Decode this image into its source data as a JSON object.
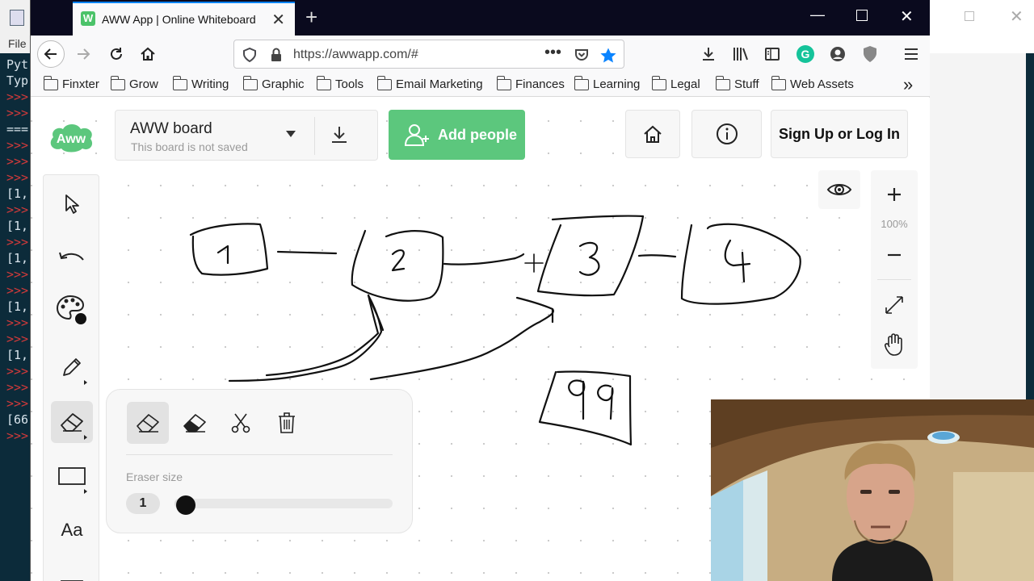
{
  "python": {
    "menu": "File",
    "lines": [
      {
        "t": "Pyt",
        "c": "w"
      },
      {
        "t": "Typ",
        "c": "w"
      },
      {
        "t": ">>>",
        "c": "r"
      },
      {
        "t": ">>>",
        "c": "r"
      },
      {
        "t": "===",
        "c": "w"
      },
      {
        "t": ">>>",
        "c": "r"
      },
      {
        "t": ">>>",
        "c": "r"
      },
      {
        "t": ">>>",
        "c": "r"
      },
      {
        "t": "[1,",
        "c": "w"
      },
      {
        "t": ">>>",
        "c": "r"
      },
      {
        "t": "[1,",
        "c": "w"
      },
      {
        "t": ">>>",
        "c": "r"
      },
      {
        "t": "[1,",
        "c": "w"
      },
      {
        "t": ">>>",
        "c": "r"
      },
      {
        "t": ">>>",
        "c": "r"
      },
      {
        "t": "[1,",
        "c": "w"
      },
      {
        "t": ">>>",
        "c": "r"
      },
      {
        "t": ">>>",
        "c": "r"
      },
      {
        "t": "[1,",
        "c": "w"
      },
      {
        "t": ">>>",
        "c": "r"
      },
      {
        "t": ">>>",
        "c": "r"
      },
      {
        "t": ">>>",
        "c": "r"
      },
      {
        "t": "[66",
        "c": "w"
      },
      {
        "t": ">>>",
        "c": "r"
      }
    ]
  },
  "browser": {
    "tab_title": "AWW App | Online Whiteboard",
    "url": "https://awwapp.com/#",
    "bookmarks": [
      "Finxter",
      "Grow",
      "Writing",
      "Graphic",
      "Tools",
      "Email Marketing",
      "Finances",
      "Learning",
      "Legal",
      "Stuff",
      "Web Assets"
    ],
    "more": "»"
  },
  "app": {
    "logo": "Aww",
    "board_name": "AWW board",
    "board_status": "This board is not saved",
    "add_people": "Add people",
    "sign_up": "Sign Up or Log In",
    "zoom_level": "100%",
    "text_tool": "Aa",
    "eraser_panel": {
      "label": "Eraser size",
      "value": "1",
      "slider_fraction": 0.05
    },
    "accent_color": "#5cc77d"
  }
}
